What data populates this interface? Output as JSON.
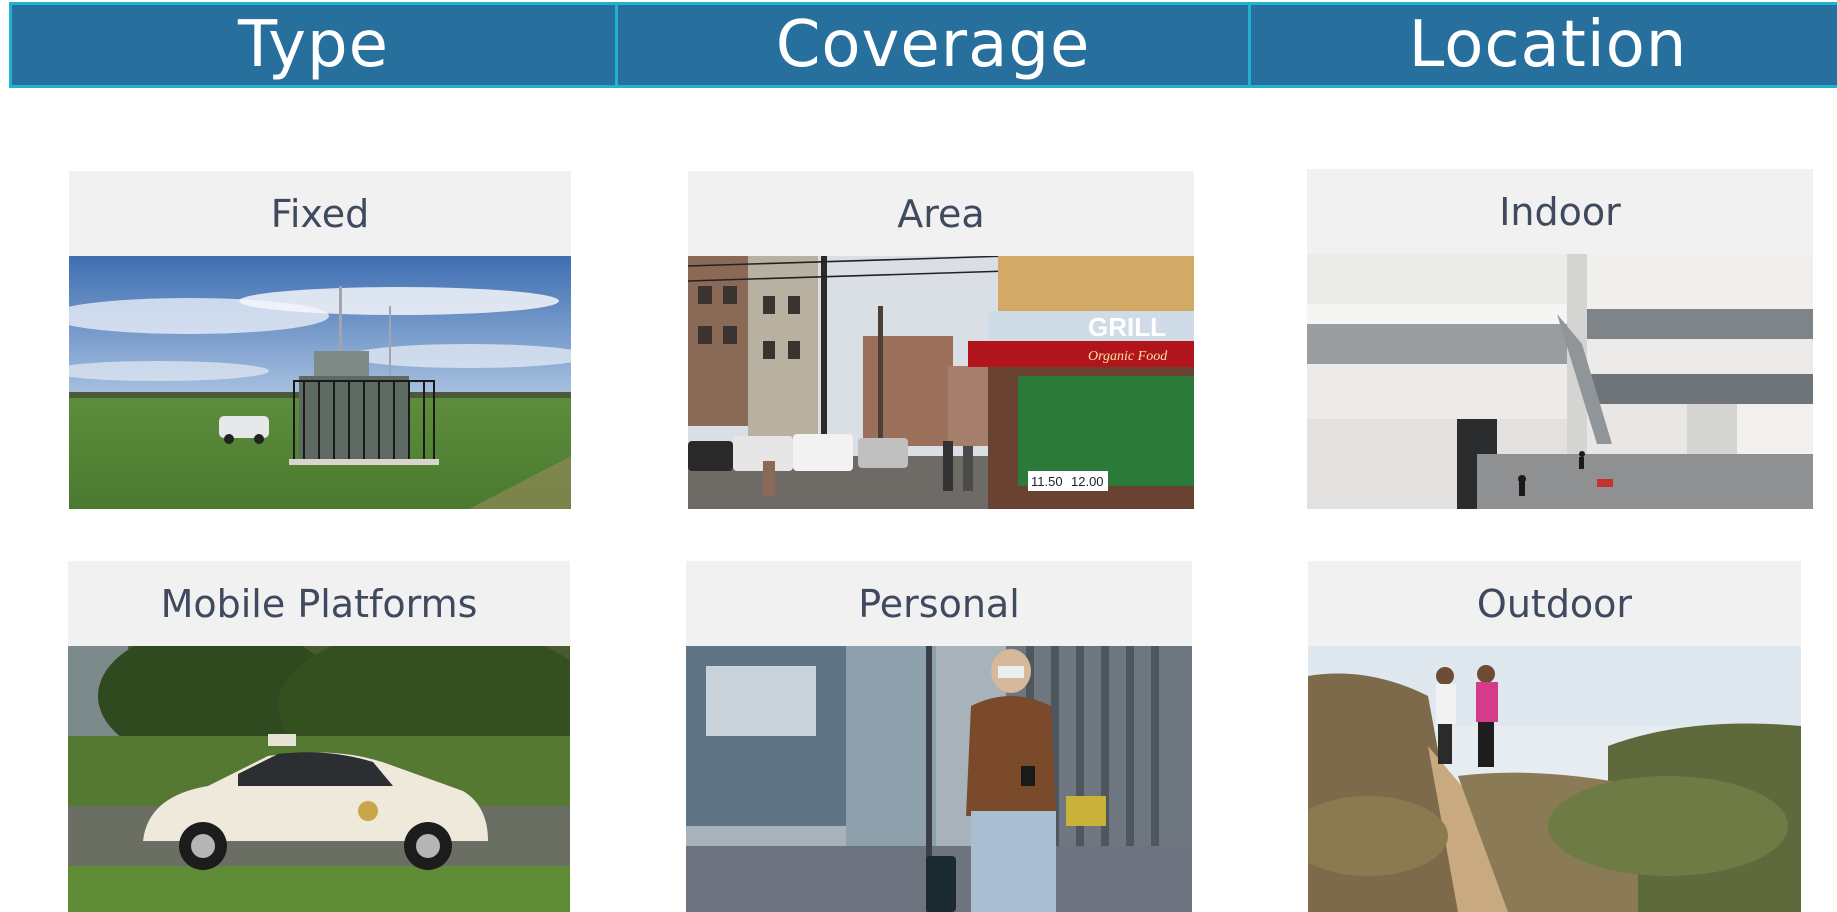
{
  "header": {
    "columns": [
      "Type",
      "Coverage",
      "Location"
    ],
    "colors": {
      "bar": "#276f9d",
      "border": "#1fb3d1",
      "text": "#ffffff"
    }
  },
  "cards": [
    {
      "label": "Fixed",
      "image": "monitoring-station-photo"
    },
    {
      "label": "Area",
      "image": "city-street-photo"
    },
    {
      "label": "Indoor",
      "image": "building-atrium-photo"
    },
    {
      "label": "Mobile Platforms",
      "image": "sensor-car-photo"
    },
    {
      "label": "Personal",
      "image": "traveler-with-phone-photo"
    },
    {
      "label": "Outdoor",
      "image": "hikers-trail-photo"
    }
  ],
  "store_sign": {
    "grill": "GRILL",
    "organic": "Organic Food",
    "prices": [
      "11.50",
      "12.00"
    ]
  },
  "colors": {
    "label_bg": "#f1f1f1",
    "label_text": "#3f4a5e"
  }
}
